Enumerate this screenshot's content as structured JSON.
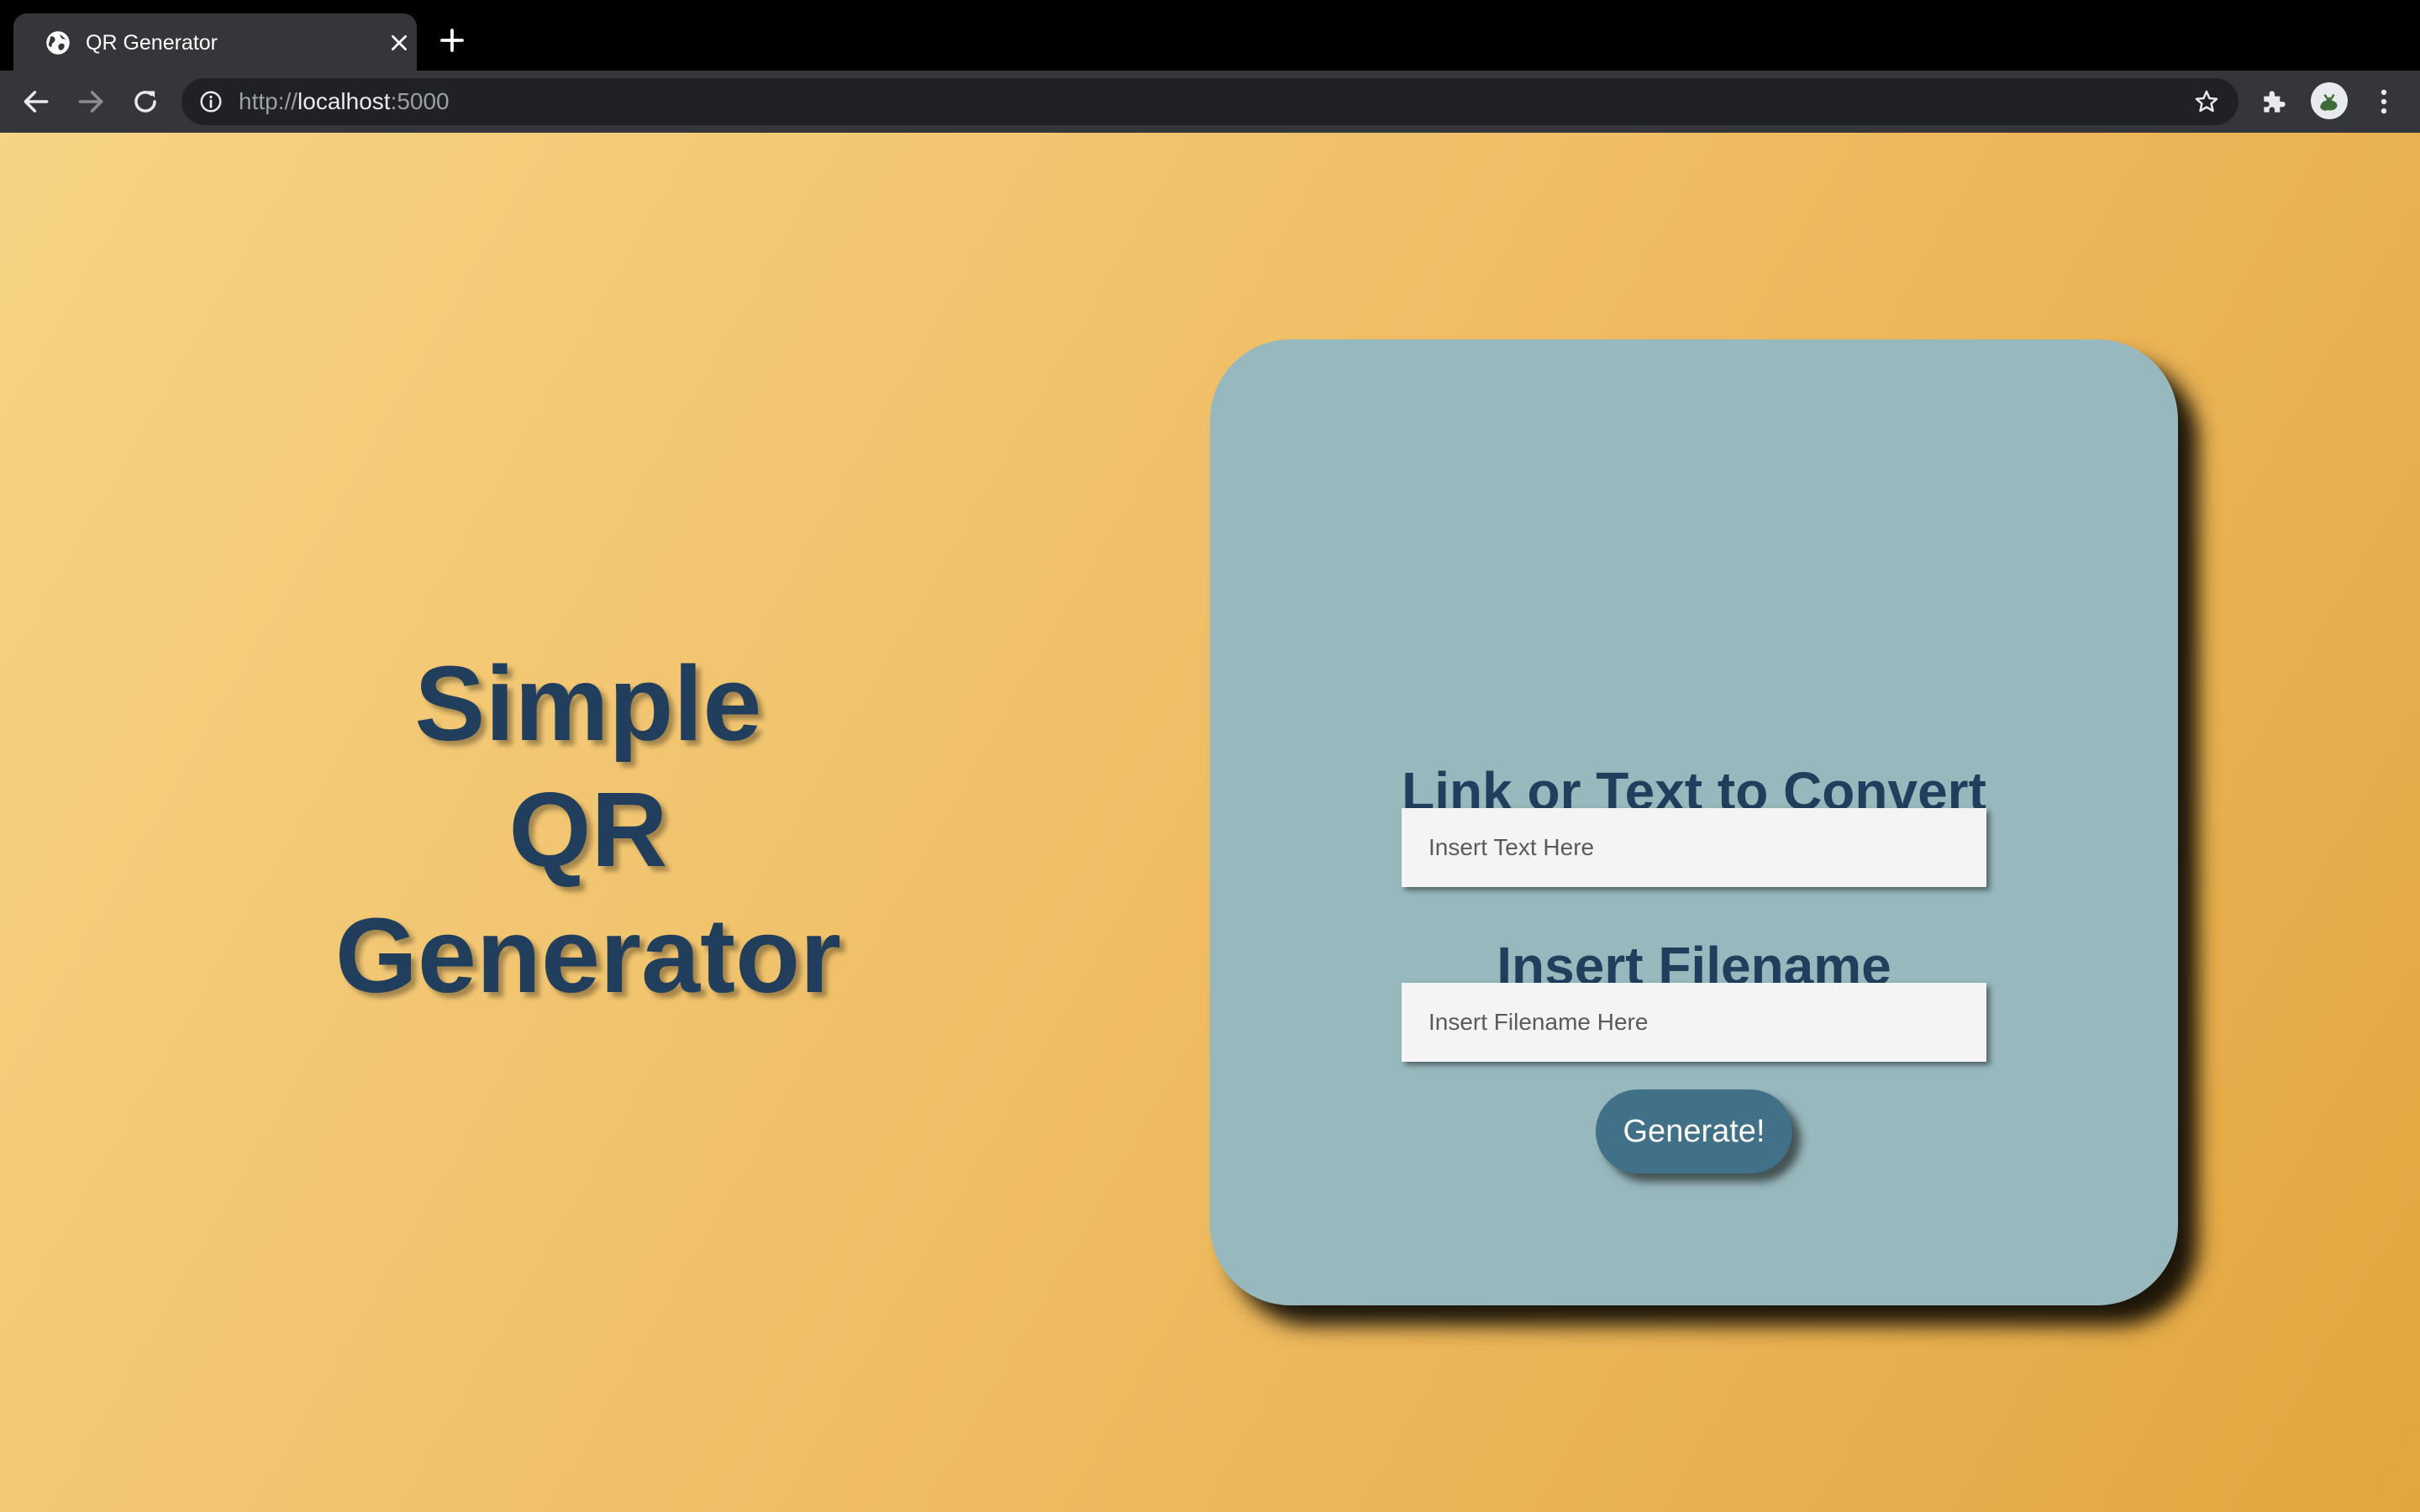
{
  "browser": {
    "tab": {
      "title": "QR Generator",
      "favicon": "globe-icon"
    },
    "new_tab_icon": "plus-icon",
    "toolbar": {
      "back_icon": "arrow-left-icon",
      "forward_icon": "arrow-right-icon",
      "reload_icon": "reload-icon",
      "url_scheme": "http://",
      "url_host": "localhost",
      "url_port": ":5000",
      "site_info_icon": "info-icon",
      "bookmark_icon": "star-icon",
      "extensions_icon": "puzzle-icon",
      "menu_icon": "kebab-menu-icon"
    }
  },
  "page": {
    "title_lines": [
      "Simple",
      "QR",
      "Generator"
    ],
    "form": {
      "text_label": "Link or Text to Convert",
      "text_placeholder": "Insert Text Here",
      "filename_label": "Insert Filename",
      "filename_placeholder": "Insert Filename Here",
      "generate_label": "Generate!"
    }
  },
  "colors": {
    "background_gradient_start": "#f6d385",
    "background_gradient_end": "#e3a63f",
    "card": "#97b8bd",
    "heading_text": "#213f5c",
    "button": "#417089",
    "button_text": "#ffffff",
    "input_background": "#f4f4f4"
  }
}
